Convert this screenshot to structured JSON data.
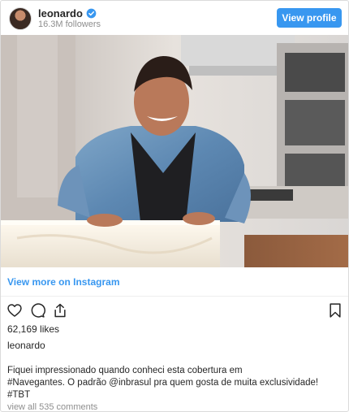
{
  "header": {
    "username": "leonardo",
    "followers": "16.3M followers",
    "view_profile_label": "View profile"
  },
  "post": {
    "view_more_label": "View more on Instagram",
    "likes": "62,169 likes",
    "caption_user": "leonardo",
    "caption_lines": [
      "Fiquei impressionado quando conheci esta cobertura em",
      "#Navegantes. O padrão @inbrasul pra quem gosta de muita exclusividade!",
      "#TBT"
    ],
    "comments_label": "view all 535 comments"
  },
  "icons": {
    "verified": "verified-badge-icon",
    "like": "heart-icon",
    "comment": "comment-icon",
    "share": "share-icon",
    "save": "bookmark-icon"
  },
  "colors": {
    "accent": "#3897f0",
    "text": "#262626",
    "muted": "#8e8e8e"
  }
}
